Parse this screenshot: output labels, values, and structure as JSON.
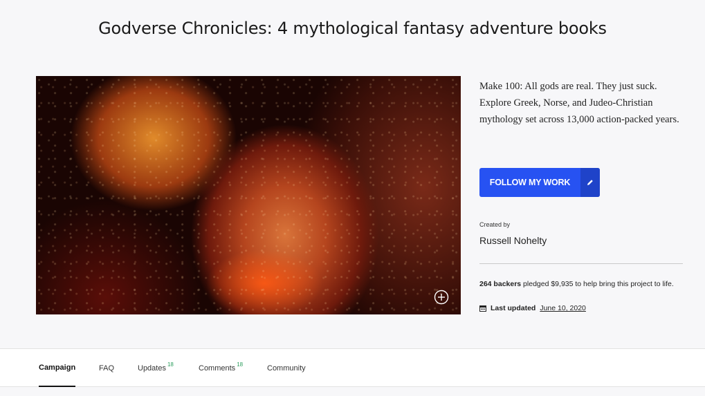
{
  "project": {
    "title": "Godverse Chronicles: 4 mythological fantasy adventure books",
    "blurb": "Make 100: All gods are real. They just suck. Explore Greek, Norse, and Judeo-Christian mythology set across 13,000 action-packed years."
  },
  "follow_button": {
    "label": "FOLLOW MY WORK"
  },
  "creator": {
    "label": "Created by",
    "name": "Russell Nohelty"
  },
  "stats": {
    "backers": "264 backers",
    "pledge_text": " pledged $9,935 to help bring this project to life.",
    "last_updated_label": "Last updated",
    "last_updated_date": "June 10, 2020"
  },
  "tabs": [
    {
      "label": "Campaign",
      "count": ""
    },
    {
      "label": "FAQ",
      "count": ""
    },
    {
      "label": "Updates",
      "count": "18"
    },
    {
      "label": "Comments",
      "count": "18"
    },
    {
      "label": "Community",
      "count": ""
    }
  ],
  "colors": {
    "accent": "#2752f2",
    "accent_dark": "#1f43c9",
    "count_green": "#2a9d5c"
  },
  "icons": {
    "zoom": "plus-circle-icon",
    "edit": "pencil-icon",
    "calendar": "calendar-icon"
  }
}
